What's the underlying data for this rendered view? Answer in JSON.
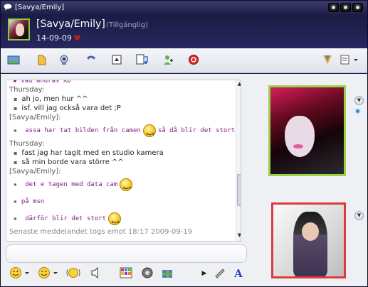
{
  "window": {
    "title": "[Savya/Emily]"
  },
  "contact": {
    "name": "[Savya/Emily]",
    "status": "(Tillgänglig)",
    "personal_message": "14-09-09",
    "heart_icon": "heart-icon"
  },
  "toolbar": {
    "icons": [
      "photo-share-icon",
      "folder-icon",
      "webcam-icon",
      "phone-icon",
      "video-call-icon",
      "share-music-icon",
      "invite-contact-icon",
      "block-icon",
      "games-icon",
      "more-menu-icon"
    ]
  },
  "chat": {
    "lines": [
      {
        "type": "who",
        "text": "Thursday:"
      },
      {
        "type": "msg",
        "text": "ah jo, men hur ^^"
      },
      {
        "type": "msg",
        "text": "isf. vill jag också vara det ;P"
      },
      {
        "type": "who",
        "text": "[Savya/Emily]:"
      },
      {
        "type": "msg-purple-emoticons",
        "text": "assa har tat bilden från camen",
        "text2": "så då blir det stort"
      },
      {
        "type": "who",
        "text": "Thursday:"
      },
      {
        "type": "msg",
        "text": "fast jag har tagit med en studio kamera"
      },
      {
        "type": "msg",
        "text": "så min borde vara större ^^"
      },
      {
        "type": "who",
        "text": "[Savya/Emily]:"
      },
      {
        "type": "msg-purple-emoticon",
        "text": "det e tagen med data cam"
      },
      {
        "type": "msg-purple",
        "text": "på msn"
      },
      {
        "type": "msg-purple-emoticon",
        "text": "därför blir det stort"
      }
    ],
    "last_message": "Senaste meddelandet togs emot 18:17 2009-09-19"
  },
  "bottom_toolbar": {
    "icons": [
      "emoticon-icon",
      "wink-icon",
      "nudge-icon",
      "voice-clip-icon",
      "background-icon",
      "speaker-icon",
      "gift-icon",
      "handwriting-icon",
      "font-icon"
    ],
    "font_label": "A"
  },
  "colors": {
    "accent_green": "#9bd24a",
    "accent_red": "#e03a3a",
    "purple_text": "#7a1a7a"
  }
}
